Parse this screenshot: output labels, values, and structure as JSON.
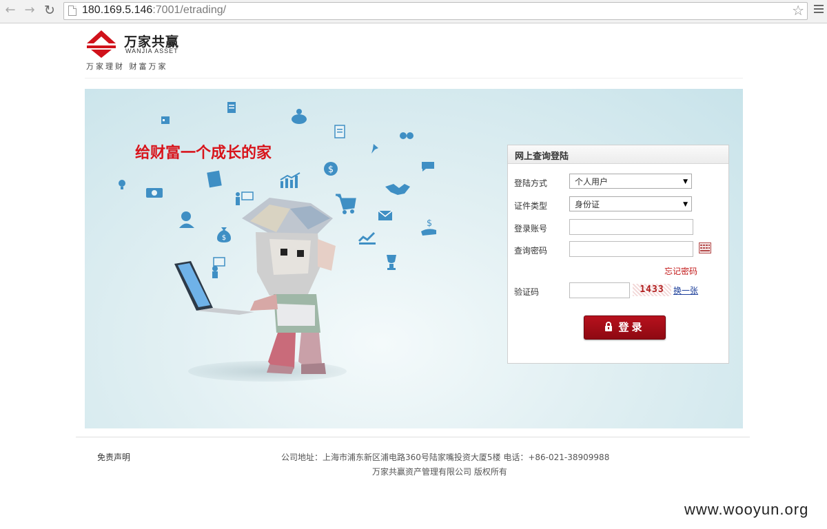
{
  "browser": {
    "url_host": "180.169.5.146",
    "url_path": ":7001/etrading/"
  },
  "header": {
    "logo_cn": "万家共赢",
    "logo_en": "WANJIA   ASSET",
    "slogan": "万家理财  财富万家"
  },
  "banner": {
    "slogan": "给财富一个成长的家",
    "icon_color": "#3f8fc4"
  },
  "login": {
    "title": "网上查询登陆",
    "login_type_label": "登陆方式",
    "login_type_value": "个人用户",
    "id_type_label": "证件类型",
    "id_type_value": "身份证",
    "account_label": "登录账号",
    "password_label": "查询密码",
    "forgot_link": "忘记密码",
    "captcha_label": "验证码",
    "captcha_text": "1433",
    "refresh_link": "换一张",
    "submit_label": "登录"
  },
  "footer": {
    "disclaimer": "免责声明",
    "address": "公司地址：上海市浦东新区浦电路360号陆家嘴投资大厦5楼 电话：+86-021-38909988",
    "copyright": "万家共赢资产管理有限公司 版权所有"
  },
  "watermark": "www.wooyun.org",
  "colors": {
    "brand_red": "#d8141b",
    "button_red": "#a10d17",
    "link_blue": "#1d3f9a"
  }
}
